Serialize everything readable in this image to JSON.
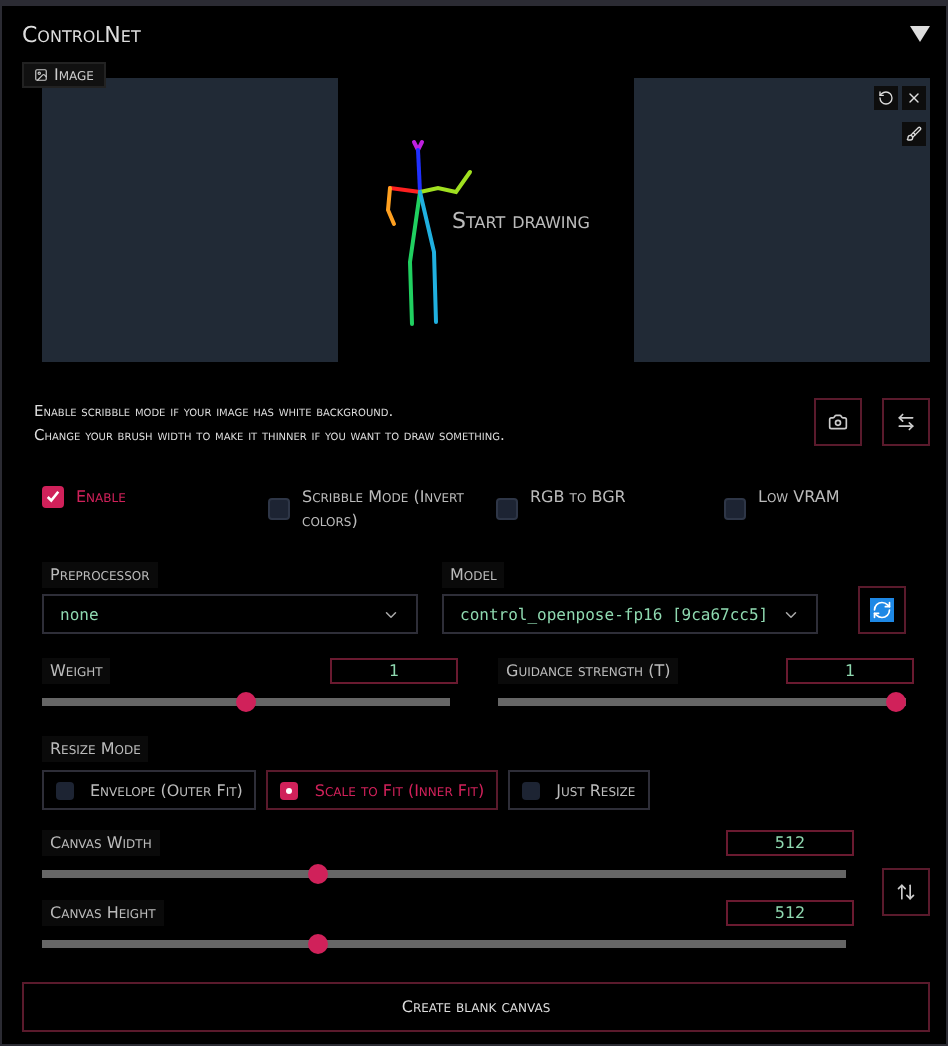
{
  "panel": {
    "title": "ControlNet",
    "expanded": true
  },
  "image_tab": {
    "label": "Image"
  },
  "canvas": {
    "prompt": "Start drawing"
  },
  "hint_lines": [
    "Enable scribble mode if your image has white background.",
    "Change your brush width to make it thinner if you want to draw something."
  ],
  "checkboxes": [
    {
      "label": "Enable",
      "checked": true
    },
    {
      "label": "Scribble Mode (Invert colors)",
      "checked": false
    },
    {
      "label": "RGB to BGR",
      "checked": false
    },
    {
      "label": "Low VRAM",
      "checked": false
    }
  ],
  "preprocessor": {
    "label": "Preprocessor",
    "value": "none"
  },
  "model": {
    "label": "Model",
    "value": "control_openpose-fp16 [9ca67cc5]"
  },
  "sliders": [
    {
      "label": "Weight",
      "value": "1",
      "level": 0.5
    },
    {
      "label": "Guidance strength (T)",
      "value": "1",
      "level": 1
    }
  ],
  "resize_mode": {
    "label": "Resize Mode",
    "options": [
      {
        "label": "Envelope (Outer Fit)",
        "selected": false
      },
      {
        "label": "Scale to Fit (Inner Fit)",
        "selected": true
      },
      {
        "label": "Just Resize",
        "selected": false
      }
    ]
  },
  "canvas_sliders": [
    {
      "label": "Canvas Width",
      "value": "512",
      "level": 0.34
    },
    {
      "label": "Canvas Height",
      "value": "512",
      "level": 0.34
    }
  ],
  "create_button": "Create blank canvas"
}
